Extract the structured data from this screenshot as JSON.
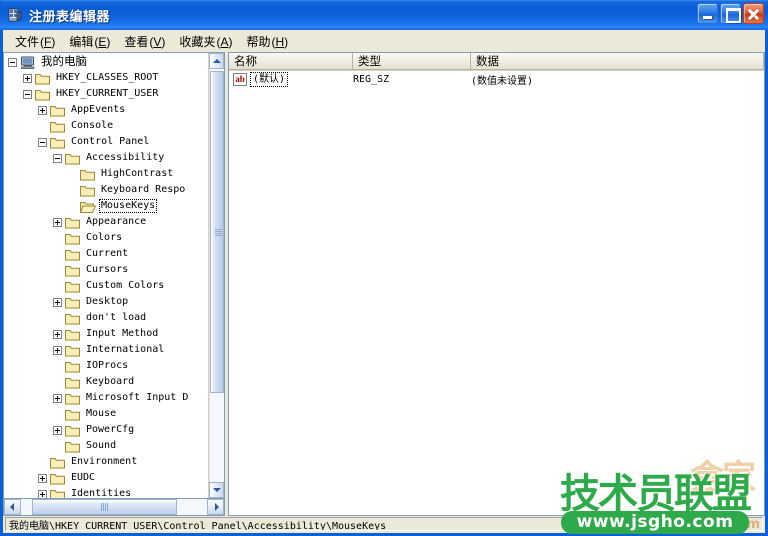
{
  "window": {
    "title": "注册表编辑器",
    "icon": "registry-editor-icon",
    "caption_buttons": {
      "minimize": "最小化",
      "maximize": "最大化",
      "close": "关闭"
    }
  },
  "menu": {
    "items": [
      {
        "text": "文件",
        "mnemonic": "F"
      },
      {
        "text": "编辑",
        "mnemonic": "E"
      },
      {
        "text": "查看",
        "mnemonic": "V"
      },
      {
        "text": "收藏夹",
        "mnemonic": "A"
      },
      {
        "text": "帮助",
        "mnemonic": "H"
      }
    ]
  },
  "tree": {
    "nodes": [
      {
        "label": "我的电脑",
        "depth": 0,
        "expander": "minus",
        "icon": "computer-icon",
        "selected": false
      },
      {
        "label": "HKEY_CLASSES_ROOT",
        "depth": 1,
        "expander": "plus",
        "icon": "folder-icon",
        "selected": false
      },
      {
        "label": "HKEY_CURRENT_USER",
        "depth": 1,
        "expander": "minus",
        "icon": "folder-icon",
        "selected": false
      },
      {
        "label": "AppEvents",
        "depth": 2,
        "expander": "plus",
        "icon": "folder-icon",
        "selected": false
      },
      {
        "label": "Console",
        "depth": 2,
        "expander": "none",
        "icon": "folder-icon",
        "selected": false
      },
      {
        "label": "Control Panel",
        "depth": 2,
        "expander": "minus",
        "icon": "folder-icon",
        "selected": false
      },
      {
        "label": "Accessibility",
        "depth": 3,
        "expander": "minus",
        "icon": "folder-icon",
        "selected": false
      },
      {
        "label": "HighContrast",
        "depth": 4,
        "expander": "none",
        "icon": "folder-icon",
        "selected": false
      },
      {
        "label": "Keyboard Respo",
        "depth": 4,
        "expander": "none",
        "icon": "folder-icon",
        "selected": false
      },
      {
        "label": "MouseKeys",
        "depth": 4,
        "expander": "none",
        "icon": "folder-open-icon",
        "selected": true
      },
      {
        "label": "Appearance",
        "depth": 3,
        "expander": "plus",
        "icon": "folder-icon",
        "selected": false
      },
      {
        "label": "Colors",
        "depth": 3,
        "expander": "none",
        "icon": "folder-icon",
        "selected": false
      },
      {
        "label": "Current",
        "depth": 3,
        "expander": "none",
        "icon": "folder-icon",
        "selected": false
      },
      {
        "label": "Cursors",
        "depth": 3,
        "expander": "none",
        "icon": "folder-icon",
        "selected": false
      },
      {
        "label": "Custom Colors",
        "depth": 3,
        "expander": "none",
        "icon": "folder-icon",
        "selected": false
      },
      {
        "label": "Desktop",
        "depth": 3,
        "expander": "plus",
        "icon": "folder-icon",
        "selected": false
      },
      {
        "label": "don't load",
        "depth": 3,
        "expander": "none",
        "icon": "folder-icon",
        "selected": false
      },
      {
        "label": "Input Method",
        "depth": 3,
        "expander": "plus",
        "icon": "folder-icon",
        "selected": false
      },
      {
        "label": "International",
        "depth": 3,
        "expander": "plus",
        "icon": "folder-icon",
        "selected": false
      },
      {
        "label": "IOProcs",
        "depth": 3,
        "expander": "none",
        "icon": "folder-icon",
        "selected": false
      },
      {
        "label": "Keyboard",
        "depth": 3,
        "expander": "none",
        "icon": "folder-icon",
        "selected": false
      },
      {
        "label": "Microsoft Input D",
        "depth": 3,
        "expander": "plus",
        "icon": "folder-icon",
        "selected": false
      },
      {
        "label": "Mouse",
        "depth": 3,
        "expander": "none",
        "icon": "folder-icon",
        "selected": false
      },
      {
        "label": "PowerCfg",
        "depth": 3,
        "expander": "plus",
        "icon": "folder-icon",
        "selected": false
      },
      {
        "label": "Sound",
        "depth": 3,
        "expander": "none",
        "icon": "folder-icon",
        "selected": false
      },
      {
        "label": "Environment",
        "depth": 2,
        "expander": "none",
        "icon": "folder-icon",
        "selected": false
      },
      {
        "label": "EUDC",
        "depth": 2,
        "expander": "plus",
        "icon": "folder-icon",
        "selected": false
      },
      {
        "label": "Identities",
        "depth": 2,
        "expander": "plus",
        "icon": "folder-icon",
        "selected": false
      }
    ]
  },
  "list": {
    "columns": [
      {
        "label": "名称"
      },
      {
        "label": "类型"
      },
      {
        "label": "数据"
      }
    ],
    "rows": [
      {
        "icon": "string-value-icon",
        "icon_text": "ab",
        "name": "(默认)",
        "type": "REG_SZ",
        "data": "(数值未设置)"
      }
    ]
  },
  "statusbar": {
    "path": "我的电脑\\HKEY_CURRENT_USER\\Control Panel\\Accessibility\\MouseKeys"
  },
  "watermark": {
    "brand": "技术员联盟",
    "url": "www.jsgho.com",
    "ghost_brand": "盒家",
    "ghost_url": ".com"
  },
  "colors": {
    "titlebar_blue": "#0a60d8",
    "menubar_beige": "#ece9d8",
    "close_red": "#cc3b16",
    "watermark_green": "#2eaa4a",
    "value_icon_red": "#a00000"
  }
}
